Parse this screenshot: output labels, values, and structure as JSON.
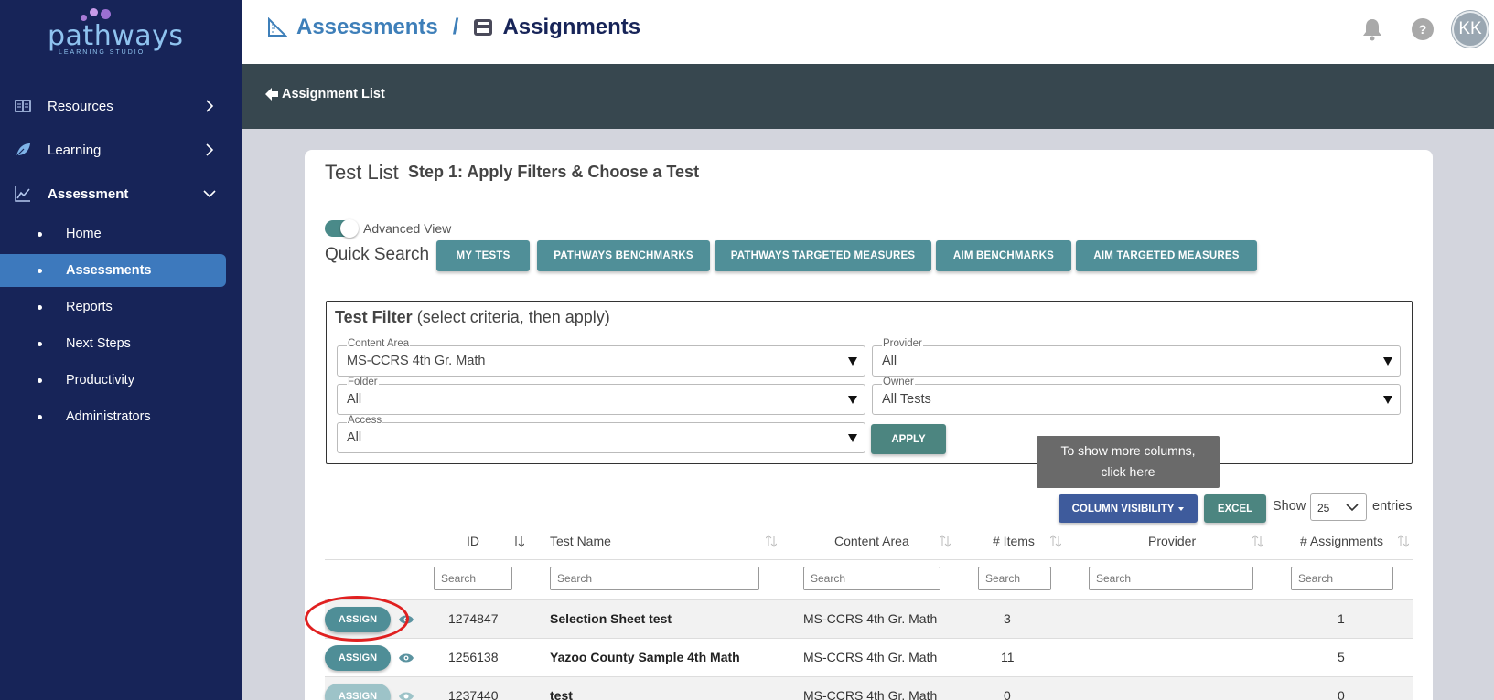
{
  "brand": {
    "name": "pathways",
    "tagline": "LEARNING STUDIO"
  },
  "sidebar": {
    "top_items": [
      {
        "label": "Resources",
        "icon": "book-icon"
      },
      {
        "label": "Learning",
        "icon": "leaf-icon"
      },
      {
        "label": "Assessment",
        "icon": "chart-line-icon"
      }
    ],
    "sub_items": [
      {
        "label": "Home"
      },
      {
        "label": "Assessments",
        "active": true
      },
      {
        "label": "Reports"
      },
      {
        "label": "Next Steps"
      },
      {
        "label": "Productivity"
      },
      {
        "label": "Administrators"
      }
    ]
  },
  "header": {
    "crumb_1": "Assessments",
    "separator": "/",
    "crumb_2": "Assignments",
    "help": "?",
    "avatar_initials": "KK"
  },
  "subheader": {
    "back_label": "Assignment List"
  },
  "card": {
    "title": "Test List",
    "subtitle": "Step 1: Apply Filters & Choose a Test",
    "advanced_view_label": "Advanced View",
    "advanced_view_on": true,
    "quick_search_label": "Quick Search",
    "quick_buttons": [
      "MY TESTS",
      "PATHWAYS BENCHMARKS",
      "PATHWAYS TARGETED MEASURES",
      "AIM BENCHMARKS",
      "AIM TARGETED MEASURES"
    ]
  },
  "filter": {
    "title_bold": "Test Filter",
    "title_rest": "(select criteria, then apply)",
    "content_area": {
      "label": "Content Area",
      "value": "MS-CCRS 4th Gr. Math"
    },
    "provider": {
      "label": "Provider",
      "value": "All"
    },
    "folder": {
      "label": "Folder",
      "value": "All"
    },
    "owner": {
      "label": "Owner",
      "value": "All Tests"
    },
    "access": {
      "label": "Access",
      "value": "All"
    },
    "apply_label": "APPLY"
  },
  "table_tools": {
    "tooltip_line1": "To show more columns,",
    "tooltip_line2": "click here",
    "column_visibility": "COLUMN VISIBILITY",
    "excel": "EXCEL",
    "show": "Show",
    "entries_value": "25",
    "entries": "entries"
  },
  "table": {
    "columns": [
      "ID",
      "Test Name",
      "Content Area",
      "# Items",
      "Provider",
      "# Assignments"
    ],
    "search_placeholder": "Search",
    "assign_label": "ASSIGN",
    "rows": [
      {
        "id": "1274847",
        "name": "Selection Sheet test",
        "content_area": "MS-CCRS 4th Gr. Math",
        "items": "3",
        "provider": "",
        "assignments": "1"
      },
      {
        "id": "1256138",
        "name": "Yazoo County Sample 4th Math",
        "content_area": "MS-CCRS 4th Gr. Math",
        "items": "11",
        "provider": "",
        "assignments": "5"
      },
      {
        "id": "1237440",
        "name": "test",
        "content_area": "MS-CCRS 4th Gr. Math",
        "items": "0",
        "provider": "",
        "assignments": "0"
      }
    ]
  },
  "colors": {
    "sidebar": "#172458",
    "active": "#3d79bd",
    "teal": "#508f98",
    "subbar": "#37474f"
  }
}
